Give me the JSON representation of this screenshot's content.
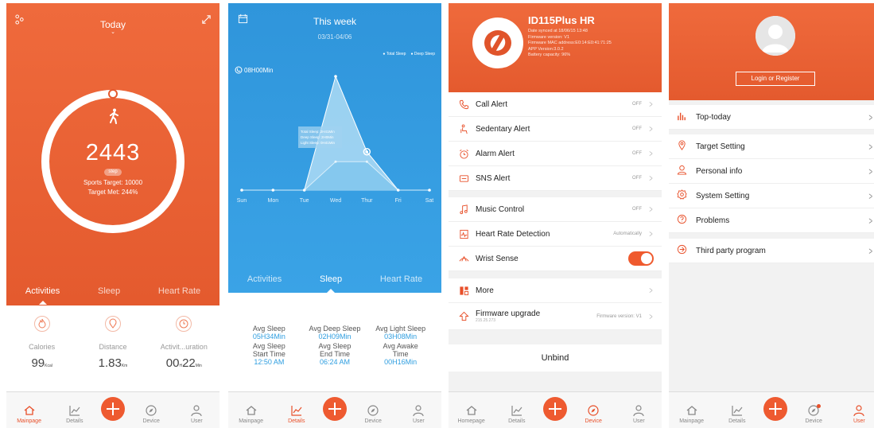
{
  "s1": {
    "title": "Today",
    "steps": "2443",
    "badge": "step",
    "sports_target": "Sports Target: 10000",
    "target_met": "Target Met: 244%",
    "progress_fraction": 0.244,
    "tabs": [
      "Activities",
      "Sleep",
      "Heart Rate"
    ],
    "stats": [
      {
        "label": "Calories",
        "value": "99",
        "unit": "Kcal"
      },
      {
        "label": "Distance",
        "value": "1.83",
        "unit": "Km"
      },
      {
        "label": "Activit...uration",
        "value": "00",
        "mid": "H",
        "value2": "22",
        "unit": "Min"
      }
    ]
  },
  "s2": {
    "title": "This week",
    "range": "03/31-04/06",
    "legend_total": "Total Sleep",
    "legend_deep": "Deep Sleep",
    "ymax_label": "08H00Min",
    "tooltip": [
      "Total Sleep: 2H41Min",
      "Deep Sleep: 2H0Min",
      "Light Sleep: 0H41Min"
    ],
    "tabs": [
      "Activities",
      "Sleep",
      "Heart Rate"
    ],
    "stats": [
      {
        "label": "Avg Sleep",
        "value": "05H34Min"
      },
      {
        "label": "Avg Deep Sleep",
        "value": "02H09Min"
      },
      {
        "label": "Avg Light Sleep",
        "value": "03H08Min"
      },
      {
        "label": "Avg Sleep Start Time",
        "value": "12:50 AM"
      },
      {
        "label": "Avg Sleep End Time",
        "value": "06:24 AM"
      },
      {
        "label": "Avg Awake Time",
        "value": "00H16Min"
      }
    ]
  },
  "chart_data": {
    "type": "area",
    "categories": [
      "Sun",
      "Mon",
      "Tue",
      "Wed",
      "Thur",
      "Fri",
      "Sat"
    ],
    "series": [
      {
        "name": "Total Sleep",
        "values": [
          0,
          0,
          0,
          8.0,
          2.7,
          0,
          0
        ]
      },
      {
        "name": "Deep Sleep",
        "values": [
          0,
          0,
          0,
          2.0,
          2.0,
          0,
          0
        ]
      }
    ],
    "ylim": [
      0,
      8
    ],
    "colors": {
      "total": "#bfe4f7",
      "deep": "#7fc6ec"
    }
  },
  "s3": {
    "device_name": "ID115Plus HR",
    "info": [
      "Date synced at 18/06/15 13:48",
      "Firmware version: V1",
      "Firmware MAC address:E0:14:E0:41:71:25",
      "APP Version:3.0.2",
      "Battery capacity: 96%"
    ],
    "group1": [
      {
        "label": "Call Alert",
        "value": "OFF",
        "icon": "phone-icon"
      },
      {
        "label": "Sedentary Alert",
        "value": "OFF",
        "icon": "sedentary-icon"
      },
      {
        "label": "Alarm Alert",
        "value": "OFF",
        "icon": "alarm-icon"
      },
      {
        "label": "SNS Alert",
        "value": "OFF",
        "icon": "sns-icon"
      }
    ],
    "group2": [
      {
        "label": "Music Control",
        "value": "OFF",
        "icon": "music-icon"
      },
      {
        "label": "Heart Rate Detection",
        "value": "Automatically",
        "icon": "heart-rate-icon"
      },
      {
        "label": "Wrist Sense",
        "value": "",
        "icon": "wrist-icon"
      }
    ],
    "more": "More",
    "firmware_upgrade": "Firmware upgrade",
    "firmware_sub": "215.25.273",
    "firmware_version": "Firmware version: V1",
    "unbind": "Unbind"
  },
  "s4": {
    "login": "Login or Register",
    "items": [
      {
        "label": "Top-today",
        "icon": "bar-chart-icon"
      },
      {
        "label": "Target Setting",
        "icon": "target-icon"
      },
      {
        "label": "Personal info",
        "icon": "person-icon"
      },
      {
        "label": "System Setting",
        "icon": "settings-icon"
      },
      {
        "label": "Problems",
        "icon": "question-icon"
      },
      {
        "label": "Third party program",
        "icon": "third-party-icon"
      }
    ]
  },
  "tabbar": [
    "Mainpage",
    "Details",
    "Device",
    "User"
  ],
  "tabbar_s3": [
    "Homepage",
    "Details",
    "Device",
    "User"
  ],
  "colors": {
    "accent": "#e8502a",
    "blue": "#2f9ee0"
  }
}
